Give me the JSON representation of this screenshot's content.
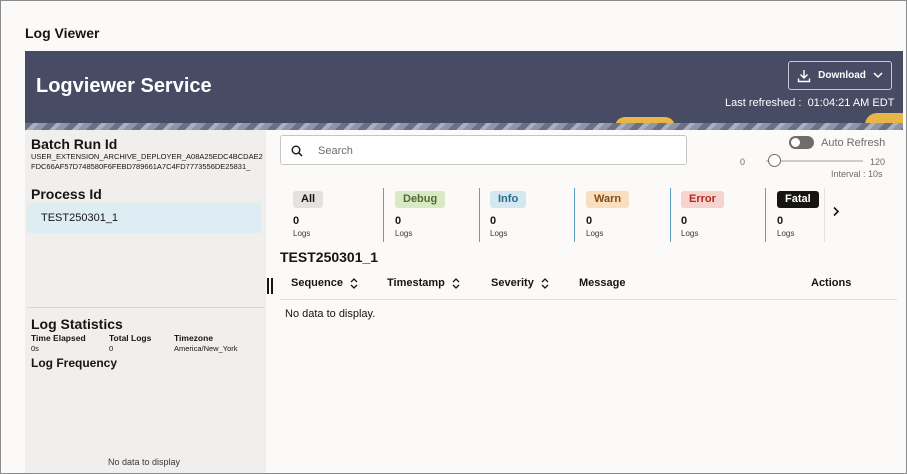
{
  "page": {
    "title": "Log Viewer"
  },
  "banner": {
    "title": "Logviewer Service",
    "download_label": "Download",
    "last_refreshed_label": "Last refreshed :",
    "last_refreshed_time": "01:04:21 AM EDT"
  },
  "left_panel": {
    "batch_run_label": "Batch Run Id",
    "batch_run_id": "USER_EXTENSION_ARCHIVE_DEPLOYER_A08A25EDC4BCDAE2FDC66AF57D748580F6FEBD789661A7C4FD7773556DE25831_",
    "process_label": "Process Id",
    "process_id": "TEST250301_1",
    "stats_label": "Log Statistics",
    "stats": {
      "time_elapsed_label": "Time Elapsed",
      "time_elapsed": "0s",
      "total_logs_label": "Total Logs",
      "total_logs": "0",
      "timezone_label": "Timezone",
      "timezone": "America/New_York"
    },
    "frequency_label": "Log Frequency",
    "frequency_empty": "No data to display"
  },
  "search": {
    "placeholder": "Search",
    "value": ""
  },
  "auto_refresh": {
    "label": "Auto Refresh",
    "enabled": false,
    "slider_min": "0",
    "slider_max": "120",
    "slider_value": 10,
    "interval_label": "Interval : 10s"
  },
  "severity_filters": [
    {
      "label": "All",
      "count": "0",
      "unit": "Logs",
      "bg": "#e4e2df",
      "fg": "#161513"
    },
    {
      "label": "Debug",
      "count": "0",
      "unit": "Logs",
      "bg": "#d7e9c5",
      "fg": "#4f6c2e"
    },
    {
      "label": "Info",
      "count": "0",
      "unit": "Logs",
      "bg": "#d5e7f0",
      "fg": "#2d6b8c"
    },
    {
      "label": "Warn",
      "count": "0",
      "unit": "Logs",
      "bg": "#f9dfc0",
      "fg": "#8a4c12"
    },
    {
      "label": "Error",
      "count": "0",
      "unit": "Logs",
      "bg": "#f7d3d0",
      "fg": "#b0281c"
    },
    {
      "label": "Fatal",
      "count": "0",
      "unit": "Logs",
      "bg": "#161513",
      "fg": "#ffffff"
    }
  ],
  "logs_table": {
    "title": "TEST250301_1",
    "columns": {
      "sequence": "Sequence",
      "timestamp": "Timestamp",
      "severity": "Severity",
      "message": "Message",
      "actions": "Actions"
    },
    "empty_text": "No data to display."
  }
}
